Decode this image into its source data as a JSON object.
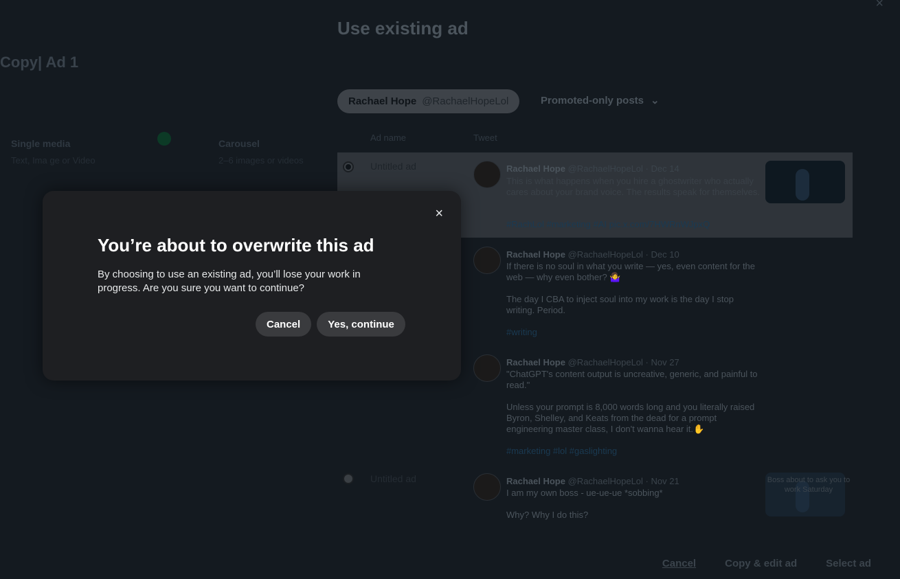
{
  "background_page": {
    "title": "Copy| Ad 1",
    "format_label": "Single media",
    "format_sub": "Text, Ima ge or Video",
    "compare_label": "Carousel",
    "compare_sub": "2–6 images or videos"
  },
  "panel": {
    "title": "Use existing ad",
    "close_icon": "×",
    "account_name": "Rachael Hope",
    "account_handle": "@RachaelHopeLol",
    "filter_label": "Promoted-only posts",
    "filter_icon": "⌄",
    "col_adname": "Ad name",
    "col_tweet": "Tweet",
    "rows": [
      {
        "ad_name": "Untitled ad",
        "author": "Rachael Hope",
        "meta": "@RachaelHopeLol · Dec 14",
        "text": "This is what happens when you hire a ghostwriter who actually cares about your brand voice. The results speak for themselves.",
        "tags": "#RachLol #marketing #AI pic.x.com/7HWRnWJpxQ"
      },
      {
        "ad_name": "",
        "author": "Rachael Hope",
        "meta": "@RachaelHopeLol · Dec 10",
        "text": "If there is no soul in what you write — yes, even content for the web — why even bother? 🤷‍♀️\n\nThe day I CBA to inject soul into my work is the day I stop writing. Period.",
        "tags": "#writing"
      },
      {
        "ad_name": "",
        "author": "Rachael Hope",
        "meta": "@RachaelHopeLol · Nov 27",
        "text": "\"ChatGPT's content output is uncreative, generic, and painful to read.\"\n\nUnless your prompt is 8,000 words long and you literally raised Byron, Shelley, and Keats from the dead for a prompt engineering master class, I don't wanna hear it.✋",
        "tags": "#marketing #lol #gaslighting"
      },
      {
        "ad_name": "Untitled ad",
        "author": "Rachael Hope",
        "meta": "@RachaelHopeLol · Nov 21",
        "text": "I am my own boss - ue-ue-ue *sobbing*\n\nWhy? Why I do this?",
        "tags": "",
        "thumb_caption": "Boss about to ask you to work Saturday"
      }
    ],
    "footer": {
      "cancel": "Cancel",
      "copy_edit": "Copy & edit ad",
      "select": "Select ad"
    }
  },
  "modal": {
    "title": "You’re about to overwrite this ad",
    "body": "By choosing to use an existing ad, you’ll lose your work in progress. Are you sure you want to continue?",
    "close_icon": "×",
    "cancel_label": "Cancel",
    "confirm_label": "Yes, continue"
  }
}
